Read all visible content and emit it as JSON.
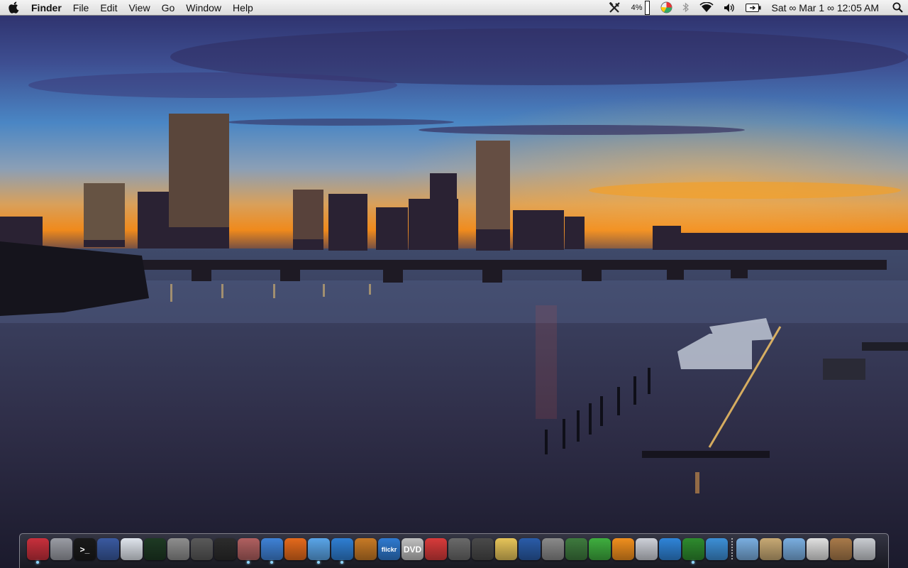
{
  "menubar": {
    "apple_icon": "apple-icon",
    "app_name": "Finder",
    "menus": [
      "File",
      "Edit",
      "View",
      "Go",
      "Window",
      "Help"
    ],
    "status": {
      "tools_icon": "hammer-wrench-icon",
      "cpu_percent": "4%",
      "battery_percent": "4%",
      "clock": "Sat ∞ Mar 1 ∞ 12:05 AM",
      "icons": [
        "hammer-wrench-icon",
        "memory-bar-icon",
        "pie-chart-icon",
        "bluetooth-icon",
        "wifi-icon",
        "volume-icon",
        "battery-icon",
        "spotlight-icon"
      ]
    }
  },
  "dock": {
    "left_items": [
      {
        "name": "finder",
        "icon": "finder-icon",
        "running": true,
        "color": "#c8303c"
      },
      {
        "name": "system-preferences",
        "icon": "gear-icon",
        "running": false,
        "color": "#9a9ca4"
      },
      {
        "name": "terminal",
        "icon": "terminal-icon",
        "running": false,
        "color": "#1a1a1a",
        "label": ">_"
      },
      {
        "name": "network",
        "icon": "network-icon",
        "running": false,
        "color": "#3a5aa0"
      },
      {
        "name": "airport",
        "icon": "wifi-icon",
        "running": false,
        "color": "#dfe4ec"
      },
      {
        "name": "activity-monitor",
        "icon": "activity-monitor-icon",
        "running": false,
        "color": "#1e3a24"
      },
      {
        "name": "disk-utility",
        "icon": "disk-utility-icon",
        "running": false,
        "color": "#8e8e8e"
      },
      {
        "name": "grab",
        "icon": "grab-icon",
        "running": false,
        "color": "#5a5a5a"
      },
      {
        "name": "dashboard",
        "icon": "dashboard-icon",
        "running": false,
        "color": "#2c2c2c"
      },
      {
        "name": "mail-stamp",
        "icon": "stamp-icon",
        "running": true,
        "color": "#b06060"
      },
      {
        "name": "safari",
        "icon": "safari-icon",
        "running": true,
        "color": "#3f82d6"
      },
      {
        "name": "firefox",
        "icon": "firefox-icon",
        "running": false,
        "color": "#e46a1c"
      },
      {
        "name": "itunes",
        "icon": "itunes-icon",
        "running": true,
        "color": "#5aa5e8"
      },
      {
        "name": "quicktime",
        "icon": "quicktime-icon",
        "running": true,
        "color": "#2f7fd3"
      },
      {
        "name": "iphoto",
        "icon": "iphoto-icon",
        "running": false,
        "color": "#c77a26"
      },
      {
        "name": "flickr-uploadr",
        "icon": "flickr-icon",
        "running": false,
        "color": "#2f7ad0",
        "label": "flickr"
      },
      {
        "name": "dvd-player",
        "icon": "dvd-icon",
        "running": false,
        "color": "#bfbfbf",
        "label": "DVD"
      },
      {
        "name": "transmission",
        "icon": "transmission-icon",
        "running": false,
        "color": "#d83b3b"
      },
      {
        "name": "audio-hijack",
        "icon": "microphone-icon",
        "running": false,
        "color": "#6a6a6a"
      },
      {
        "name": "film-editor",
        "icon": "film-icon",
        "running": false,
        "color": "#4a4a4a"
      },
      {
        "name": "notes",
        "icon": "notepad-icon",
        "running": false,
        "color": "#e6c45a"
      },
      {
        "name": "expose",
        "icon": "expose-icon",
        "running": false,
        "color": "#2a5ca8"
      },
      {
        "name": "vmware",
        "icon": "vmware-icon",
        "running": false,
        "color": "#8a8a8a"
      },
      {
        "name": "numbers-chart",
        "icon": "bar-chart-icon",
        "running": false,
        "color": "#3e7a3e"
      },
      {
        "name": "cyberduck",
        "icon": "duck-icon",
        "running": false,
        "color": "#3fae3f"
      },
      {
        "name": "pages",
        "icon": "pages-icon",
        "running": false,
        "color": "#f08f1e"
      },
      {
        "name": "script-editor",
        "icon": "script-editor-icon",
        "running": false,
        "color": "#cdd0d8"
      },
      {
        "name": "wireshark",
        "icon": "wave-icon",
        "running": false,
        "color": "#2f84d8"
      },
      {
        "name": "adium",
        "icon": "adium-icon",
        "running": true,
        "color": "#2e8b2e"
      },
      {
        "name": "xcode-utility",
        "icon": "starburst-icon",
        "running": false,
        "color": "#3d8fd6"
      }
    ],
    "right_items": [
      {
        "name": "applications-folder",
        "icon": "folder-icon",
        "running": false,
        "color": "#7aaee0"
      },
      {
        "name": "documents-folder",
        "icon": "documents-icon",
        "running": false,
        "color": "#c7a974"
      },
      {
        "name": "downloads-folder",
        "icon": "folder-icon",
        "running": false,
        "color": "#7aaee0"
      },
      {
        "name": "mail-drafts",
        "icon": "mail-icon",
        "running": false,
        "color": "#e0e0e0"
      },
      {
        "name": "photo-stack",
        "icon": "photo-stack-icon",
        "running": false,
        "color": "#a87a4a"
      },
      {
        "name": "trash",
        "icon": "trash-icon",
        "running": false,
        "color": "#c9ccd1"
      }
    ]
  }
}
